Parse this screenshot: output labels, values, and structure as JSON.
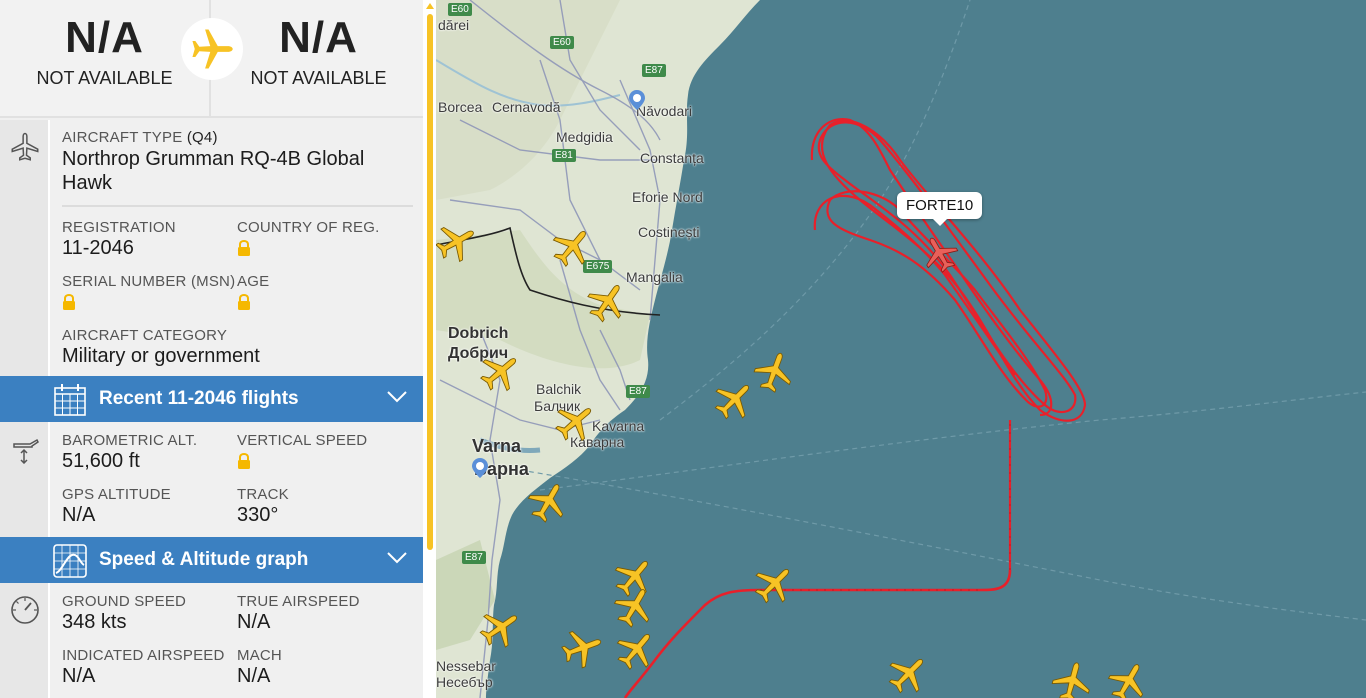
{
  "route": {
    "origin_code": "N/A",
    "origin_city": "NOT AVAILABLE",
    "dest_code": "N/A",
    "dest_city": "NOT AVAILABLE"
  },
  "aircraft": {
    "type_label": "AIRCRAFT TYPE",
    "type_code": "(Q4)",
    "type_name": "Northrop Grumman RQ-4B Global Hawk",
    "registration_label": "REGISTRATION",
    "registration": "11-2046",
    "country_label": "COUNTRY OF REG.",
    "serial_label": "SERIAL NUMBER (MSN)",
    "age_label": "AGE",
    "category_label": "AIRCRAFT CATEGORY",
    "category": "Military or government"
  },
  "recent_flights": {
    "title": "Recent 11-2046 flights"
  },
  "altitude": {
    "baro_label": "BAROMETRIC ALT.",
    "baro_value": "51,600 ft",
    "vs_label": "VERTICAL SPEED",
    "gps_label": "GPS ALTITUDE",
    "gps_value": "N/A",
    "track_label": "TRACK",
    "track_value": "330°"
  },
  "graph": {
    "title": "Speed & Altitude graph"
  },
  "speed": {
    "ground_label": "GROUND SPEED",
    "ground_value": "348 kts",
    "true_label": "TRUE AIRSPEED",
    "true_value": "N/A",
    "indicated_label": "INDICATED AIRSPEED",
    "indicated_value": "N/A",
    "mach_label": "MACH",
    "mach_value": "N/A"
  },
  "map": {
    "selected_callsign": "FORTE10",
    "labels": {
      "darei": "dărei",
      "borcea": "Borcea",
      "cernavoda": "Cernavodă",
      "navodari": "Năvodari",
      "medgidia": "Medgidia",
      "constanta": "Constanța",
      "eforie": "Eforie Nord",
      "costinesti": "Costinești",
      "mangalia": "Mangalia",
      "dobrich": "Dobrich",
      "dobrich_cyr": "Добрич",
      "balchik": "Balchik",
      "balchik_cyr": "Балчик",
      "kavarna": "Kavarna",
      "kavarna_cyr": "Каварна",
      "varna": "Varna",
      "varna_cyr": "Варна",
      "nessebar": "Nessebar",
      "nessebar_cyr": "Несебър"
    },
    "roads": [
      "E60",
      "E60",
      "E87",
      "E81",
      "E675",
      "E87",
      "E87"
    ]
  },
  "colors": {
    "accent_blue": "#3b80c1",
    "track_red": "#e8202a",
    "plane_yellow": "#f7c325",
    "sea": "#4e7f8e",
    "land": "#dfe5d3"
  }
}
